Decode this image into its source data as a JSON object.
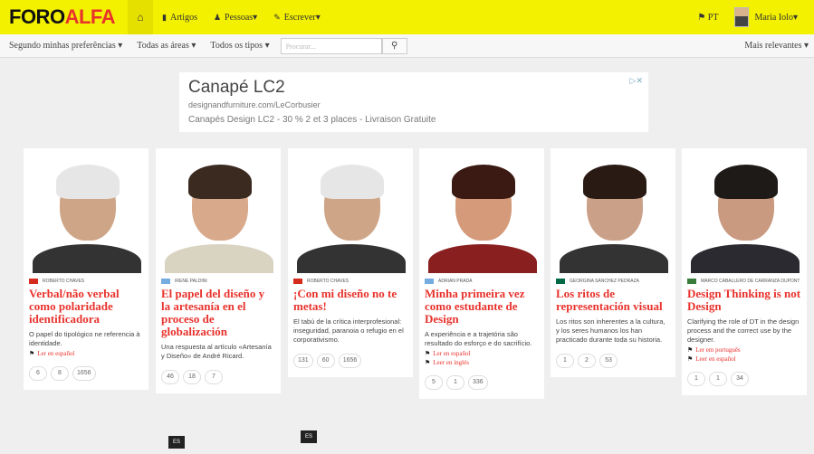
{
  "header": {
    "logo_a": "FORO",
    "logo_b": "ALFA",
    "nav": [
      {
        "icon": "book-icon",
        "label": "Artigos"
      },
      {
        "icon": "user-icon",
        "label": "Pessoas"
      },
      {
        "icon": "pencil-icon",
        "label": "Escrever"
      }
    ],
    "lang": "PT",
    "user": "Maria Iolo"
  },
  "filters": {
    "preferences": "Segundo minhas preferências",
    "areas": "Todas as áreas",
    "types": "Todos os tipos",
    "search_placeholder": "Procurar...",
    "sort": "Mais relevantes"
  },
  "ad": {
    "title": "Canapé LC2",
    "url": "designandfurniture.com/LeCorbusier",
    "desc": "Canapés Design LC2 - 30 % 2 et 3 places - Livraison Gratuite",
    "close": "▷✕"
  },
  "cards": [
    {
      "author": "ROBERTO CHAVES",
      "flag": "#d52b1e",
      "title": "Verbal/não verbal como polaridade identificadora",
      "excerpt": "O papel do tipológico ne referencia à identidade.",
      "links": [
        "Ler en español"
      ],
      "stats": [
        "6",
        "8",
        "1656"
      ],
      "badge": "",
      "hair": "#e6e6e6",
      "skin": "#cfa587",
      "shirt": "#333"
    },
    {
      "author": "IRENE PALDINI",
      "flag": "#74acdf",
      "title": "El papel del diseño y la artesanía en el proceso de globalización",
      "excerpt": "Una respuesta al artículo «Artesanía y Diseño» de André Ricard.",
      "links": [],
      "stats": [
        "46",
        "18",
        "7"
      ],
      "badge": "ES",
      "hair": "#3a2a20",
      "skin": "#d8a98a",
      "shirt": "#d9d3c2"
    },
    {
      "author": "ROBERTO CHAVES",
      "flag": "#d52b1e",
      "title": "¡Con mi diseño no te metas!",
      "excerpt": "El tabú de la crítica interprofesional: inseguridad, paranoia o refugio en el corporativismo.",
      "links": [],
      "stats": [
        "131",
        "60",
        "1656"
      ],
      "badge": "ES",
      "hair": "#e6e6e6",
      "skin": "#cfa587",
      "shirt": "#333"
    },
    {
      "author": "ADRIAN PRADA",
      "flag": "#74acdf",
      "title": "Minha primeira vez como estudante de Design",
      "excerpt": "A experiência e a trajetória são resultado do esforço e do sacrifício.",
      "links": [
        "Ler en español",
        "Leer en inglés"
      ],
      "stats": [
        "5",
        "1",
        "336"
      ],
      "badge": "",
      "hair": "#3a1a12",
      "skin": "#d49a7a",
      "shirt": "#8a1f1f"
    },
    {
      "author": "GEORGINA SÁNCHEZ PEDRAZA",
      "flag": "#006847",
      "title": "Los ritos de representación visual",
      "excerpt": "Los ritos son inherentes a la cultura, y los seres humanos los han practicado durante toda su historia.",
      "links": [],
      "stats": [
        "1",
        "2",
        "53"
      ],
      "badge": "",
      "hair": "#2a1a14",
      "skin": "#caa188",
      "shirt": "#333"
    },
    {
      "author": "MARCO CABALLERO DE CARRANZA DUPONT",
      "flag": "#3a7d3a",
      "title": "Design Thinking is not Design",
      "excerpt": "Clarifying the role of DT in the design process and the correct use by the designer.",
      "links": [
        "Ler em português",
        "Leer en español"
      ],
      "stats": [
        "1",
        "1",
        "34"
      ],
      "badge": "",
      "hair": "#1e1a18",
      "skin": "#c99a80",
      "shirt": "#2a2a30"
    }
  ]
}
